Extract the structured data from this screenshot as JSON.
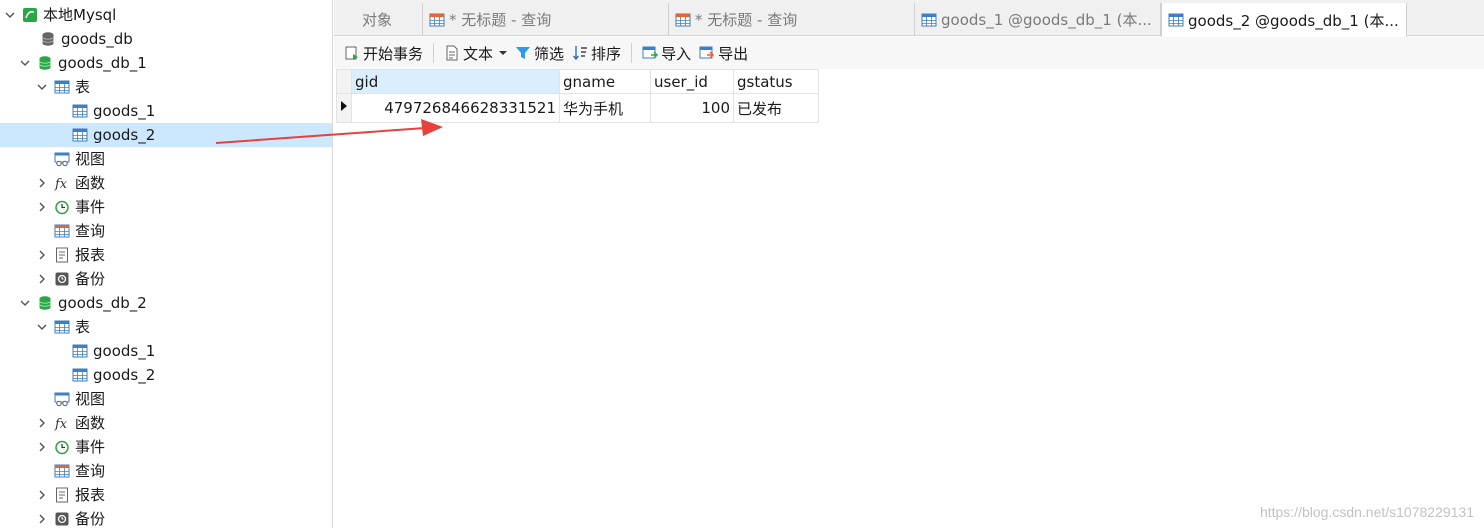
{
  "sidebar": {
    "connection": "本地Mysql",
    "db_plain": "goods_db",
    "db1": {
      "name": "goods_db_1",
      "tables_label": "表",
      "table_items": [
        "goods_1",
        "goods_2"
      ],
      "views_label": "视图",
      "functions_label": "函数",
      "events_label": "事件",
      "queries_label": "查询",
      "reports_label": "报表",
      "backups_label": "备份"
    },
    "db2": {
      "name": "goods_db_2",
      "tables_label": "表",
      "table_items": [
        "goods_1",
        "goods_2"
      ],
      "views_label": "视图",
      "functions_label": "函数",
      "events_label": "事件",
      "queries_label": "查询",
      "reports_label": "报表",
      "backups_label": "备份"
    }
  },
  "tabs": [
    {
      "label": "对象"
    },
    {
      "label": "* 无标题 - 查询"
    },
    {
      "label": "* 无标题 - 查询"
    },
    {
      "label": "goods_1 @goods_db_1 (本..."
    },
    {
      "label": "goods_2 @goods_db_1 (本..."
    }
  ],
  "toolbar": {
    "begin_transaction": "开始事务",
    "text": "文本",
    "filter": "筛选",
    "sort": "排序",
    "import": "导入",
    "export": "导出"
  },
  "grid": {
    "columns": [
      "gid",
      "gname",
      "user_id",
      "gstatus"
    ],
    "rows": [
      {
        "gid": "479726846628331521",
        "gname": "华为手机",
        "user_id": "100",
        "gstatus": "已发布"
      }
    ]
  },
  "watermark": "https://blog.csdn.net/s1078229131",
  "colors": {
    "selection": "#cce8ff",
    "db_icon": "#2aa745",
    "table_icon": "#3c7fc4",
    "arrow": "#e8403d"
  }
}
